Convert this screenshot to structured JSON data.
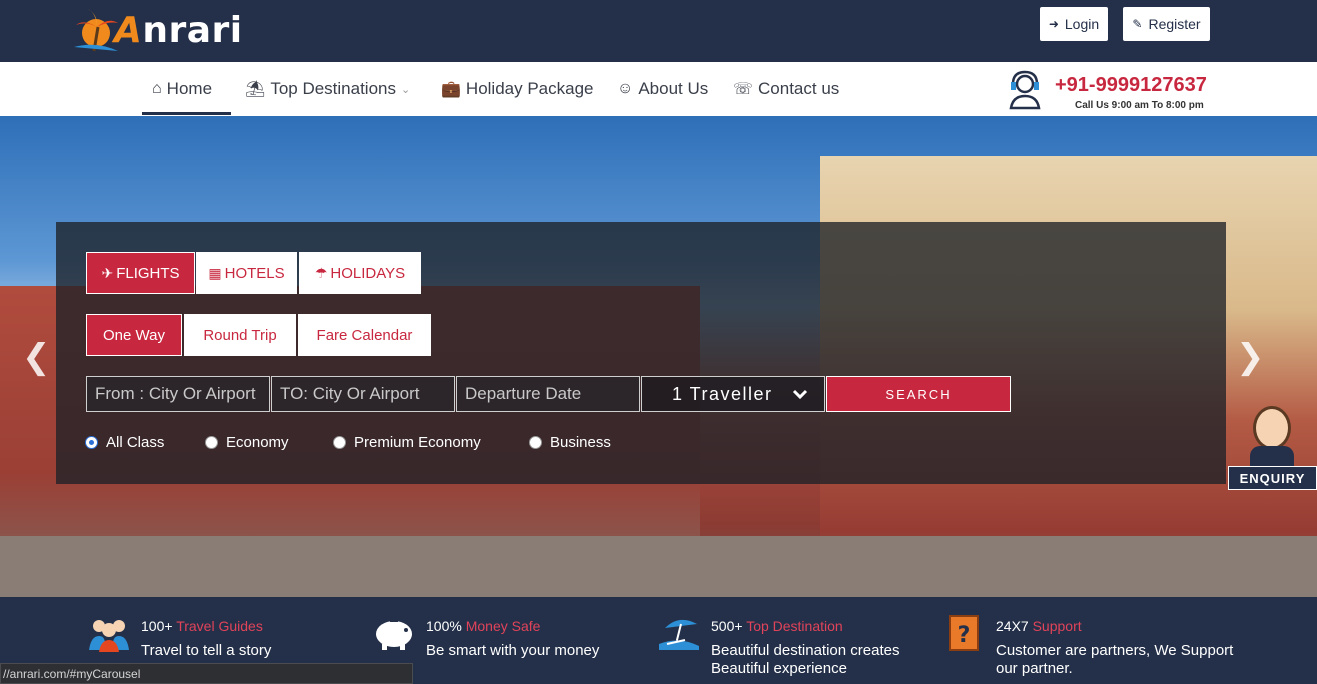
{
  "brand": {
    "logo_text": "Anrari",
    "logo_initial": "A",
    "logo_rest": "nrari"
  },
  "auth": {
    "login_label": "Login",
    "register_label": "Register"
  },
  "nav": {
    "home": "Home",
    "top_destinations": "Top Destinations",
    "holiday_package": "Holiday Package",
    "about_us": "About Us",
    "contact_us": "Contact us"
  },
  "contact": {
    "phone": "+91-9999127637",
    "hours": "Call Us 9:00 am To 8:00 pm"
  },
  "search": {
    "tabs": {
      "flights": "FLIGHTS",
      "hotels": "HOTELS",
      "holidays": "HOLIDAYS",
      "active": "flights"
    },
    "trip_types": {
      "one_way": "One Way",
      "round_trip": "Round Trip",
      "fare_calendar": "Fare Calendar",
      "active": "one_way"
    },
    "from_placeholder": "From : City Or Airport",
    "to_placeholder": "TO: City Or Airport",
    "date_placeholder": "Departure Date",
    "traveller": "1 Traveller",
    "search_label": "SEARCH",
    "classes": {
      "all": "All Class",
      "economy": "Economy",
      "premium": "Premium Economy",
      "business": "Business",
      "selected": "all"
    }
  },
  "enquiry_label": "ENQUIRY",
  "features": [
    {
      "count": "100+",
      "highlight": "Travel Guides",
      "desc": "Travel to tell a story",
      "icon": "guides-icon"
    },
    {
      "count": "100%",
      "highlight": "Money Safe",
      "desc": "Be smart with your money",
      "icon": "piggy-bank-icon"
    },
    {
      "count": "500+",
      "highlight": "Top Destination",
      "desc": "Beautiful destination creates Beautiful experience",
      "icon": "beach-icon"
    },
    {
      "count": "24X7",
      "highlight": "Support",
      "desc": "Customer are partners, We Support our partner.",
      "icon": "support-icon"
    }
  ],
  "status_url": "//anrari.com/#myCarousel",
  "colors": {
    "primary": "#243049",
    "accent": "#c8283f",
    "logo_orange": "#f08a1c"
  }
}
